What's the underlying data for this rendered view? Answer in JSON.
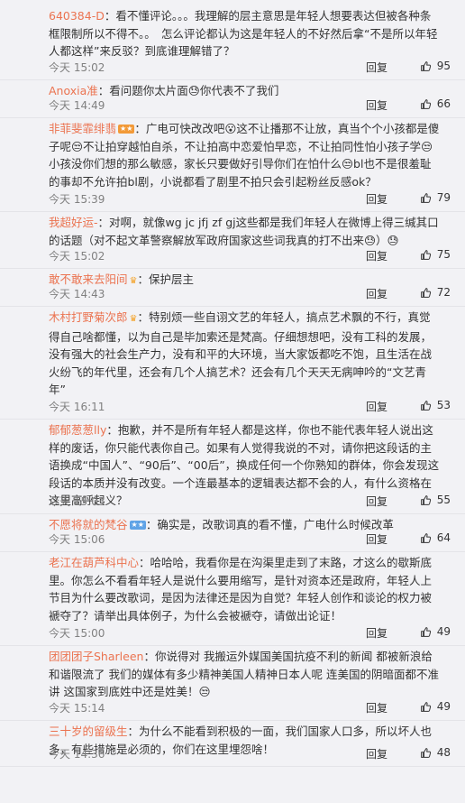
{
  "like_icon": "thumbs-up-icon",
  "comments": [
    {
      "user": "640384-D",
      "badge": "",
      "text": "看不懂评论。。。我理解的层主意思是年轻人想要表达但被各种条框限制所以不得不。。　怎么评论都认为这是年轻人的不好然后拿“不是所以年轻人都这样”来反驳？到底谁理解错了？",
      "time": "今天 15:02",
      "reply": "回复",
      "likes": "95"
    },
    {
      "user": "Anoxia准",
      "badge": "",
      "text": "看问题你太片面😓你代表不了我们",
      "time": "今天 14:49",
      "reply": "回复",
      "likes": "66"
    },
    {
      "user": "非菲斐霏绯翡",
      "badge": "vip",
      "text": "广电可快改改吧😮这不让播那不让放，真当个个小孩都是傻子呢😒不让拍穿越怕自杀，不让拍高中恋爱怕早恋，不让拍同性怕小孩子学😒小孩没你们想的那么敏感，家长只要做好引导你们在怕什么😒bl也不是很羞耻的事却不允许拍bl剧，小说都看了剧里不拍只会引起粉丝反感ok？",
      "time": "今天 15:39",
      "reply": "回复",
      "likes": "79"
    },
    {
      "user": "我超好运-",
      "badge": "",
      "text": "对啊，就像wg jc jfj zf gj这些都是我们年轻人在微博上得三缄其口的话题（对不起文革警察解放军政府国家这些词我真的打不出来😓）😓",
      "time": "今天 15:02",
      "reply": "回复",
      "likes": "75"
    },
    {
      "user": "敢不敢来去阳间",
      "badge": "crown",
      "text": "保护层主",
      "time": "今天 14:43",
      "reply": "回复",
      "likes": "72"
    },
    {
      "user": "木村打野菊次郎",
      "badge": "crown",
      "text": "特别烦一些自诩文艺的年轻人，搞点艺术飘的不行，真觉得自己啥都懂，以为自己是毕加索还是梵高。仔细想想吧，没有工科的发展，没有强大的社会生产力，没有和平的大环境，当大家饭都吃不饱，且生活在战火纷飞的年代里，还会有几个人搞艺术？还会有几个天天无病呻吟的“文艺青年”",
      "time": "今天 16:11",
      "reply": "回复",
      "likes": "53"
    },
    {
      "user": "郁郁葱葱lly",
      "badge": "",
      "text": "抱歉，并不是所有年轻人都是这样，你也不能代表年轻人说出这样的废话，你只能代表你自己。如果有人觉得我说的不对，请你把这段话的主语换成“中国人”、“90后”、“00后”，换成任何一个你熟知的群体，你会发现这段话的本质并没有改变。一个连最基本的逻辑表达都不会的人，有什么资格在这里高呼起义？",
      "time": "今天 15:03",
      "reply": "回复",
      "likes": "55"
    },
    {
      "user": "不愿将就的梵谷",
      "badge": "blue",
      "text": "确实是，改歌词真的看不懂，广电什么时候改革",
      "time": "今天 15:06",
      "reply": "回复",
      "likes": "64"
    },
    {
      "user": "老江在葫芦科中心",
      "badge": "",
      "text": "哈哈哈，我看你是在沟渠里走到了末路，才这么的歇斯底里。你怎么不看看年轻人是说什么要用缩写，是针对资本还是政府，年轻人上节目为什么要改歌词，是因为法律还是因为自觉？年轻人创作和谈论的权力被褫夺了？请举出具体例子，为什么会被褫夺，请做出论证！",
      "time": "今天 15:00",
      "reply": "回复",
      "likes": "49"
    },
    {
      "user": "团团团子Sharleen",
      "badge": "",
      "text": "你说得对 我搬运外媒国美国抗疫不利的新闻 都被新浪给和谐限流了 我们的媒体有多少精神美国人精神日本人呢 连美国的阴暗面都不准讲 这国家到底姓中还是姓美！😒",
      "time": "今天 15:14",
      "reply": "回复",
      "likes": "49"
    },
    {
      "user": "三十岁的留级生",
      "badge": "",
      "text": "为什么不能看到积极的一面，我们国家人口多，所以坏人也多，有些措施是必须的，你们在这里埋怨啥！",
      "time": "今天 14:36",
      "reply": "回复",
      "likes": "48"
    }
  ]
}
